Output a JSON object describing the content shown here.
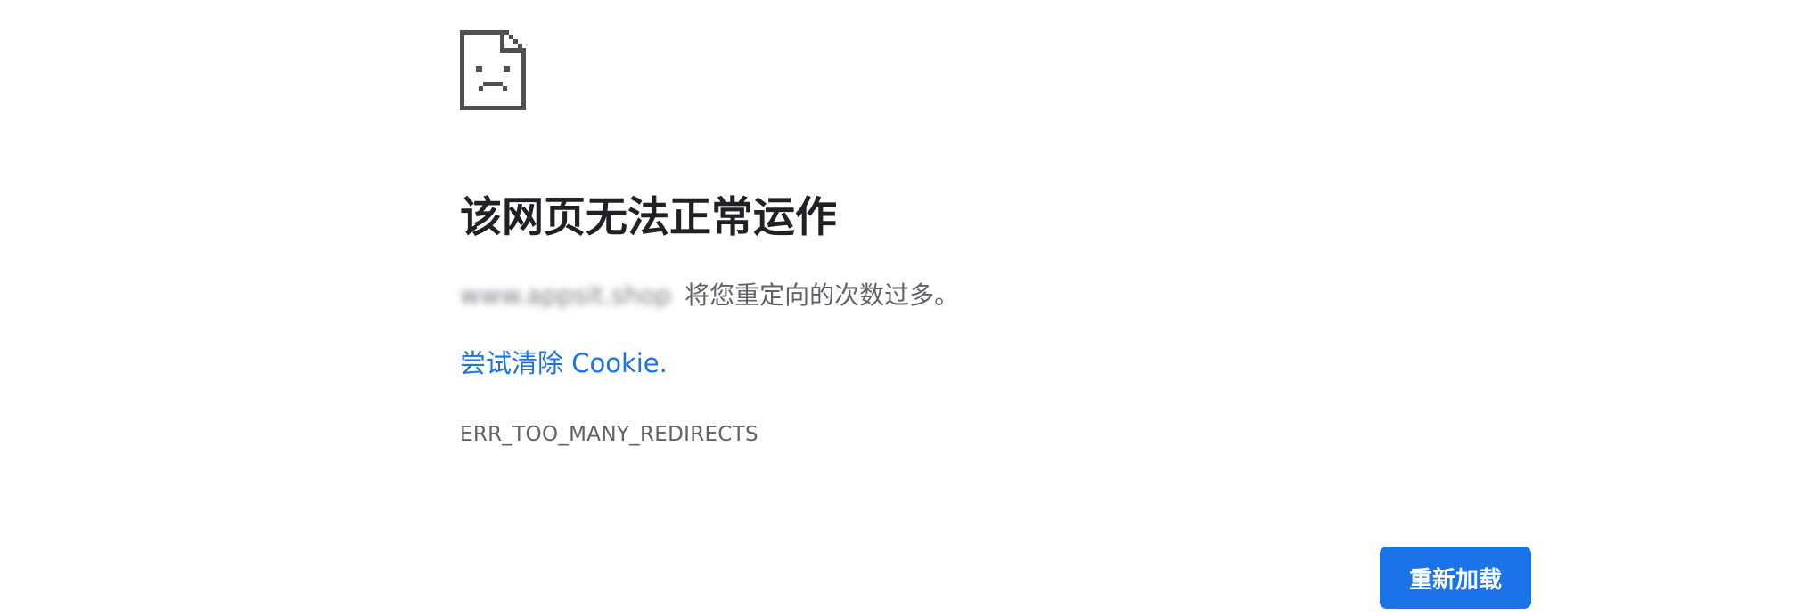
{
  "page": {
    "title": "该网页无法正常运作",
    "summary_host": "www.appsit.shop",
    "summary_text": "将您重定向的次数过多。",
    "suggestion_link": "尝试清除 Cookie.",
    "error_code": "ERR_TOO_MANY_REDIRECTS"
  },
  "actions": {
    "reload_label": "重新加载"
  },
  "icons": {
    "error": "sad-page-icon"
  },
  "colors": {
    "link": "#1a73e8",
    "button_bg": "#1a73e8",
    "button_text": "#ffffff",
    "title": "#202124",
    "secondary_text": "#5f6368",
    "icon": "#505050"
  }
}
